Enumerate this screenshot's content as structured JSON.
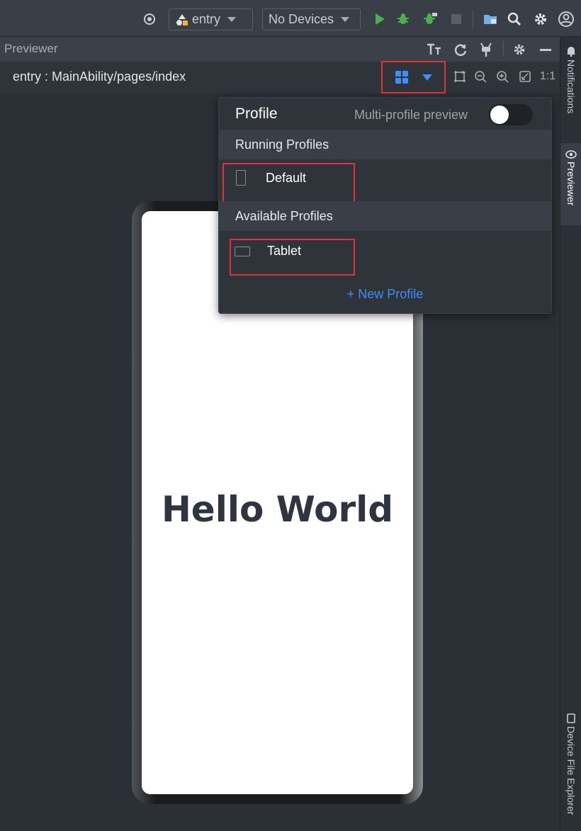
{
  "toolbar": {
    "module": "entry",
    "device": "No Devices"
  },
  "panel": {
    "title": "Previewer"
  },
  "path_bar": {
    "path": "entry : MainAbility/pages/index",
    "ratio": "1:1"
  },
  "popup": {
    "title": "Profile",
    "multi_preview_label": "Multi-profile preview",
    "multi_preview_enabled": false,
    "running_header": "Running Profiles",
    "running": [
      {
        "label": "Default",
        "icon": "phone-icon"
      }
    ],
    "available_header": "Available Profiles",
    "available": [
      {
        "label": "Tablet",
        "icon": "tablet-icon"
      }
    ],
    "new_profile": "+ New Profile"
  },
  "preview": {
    "text": "Hello World"
  },
  "side_tabs": {
    "notifications": "Notifications",
    "previewer": "Previewer",
    "device_file_explorer": "Device File Explorer"
  },
  "colors": {
    "accent": "#3e8ef7",
    "highlight": "#e0343a",
    "run": "#4caf50"
  }
}
